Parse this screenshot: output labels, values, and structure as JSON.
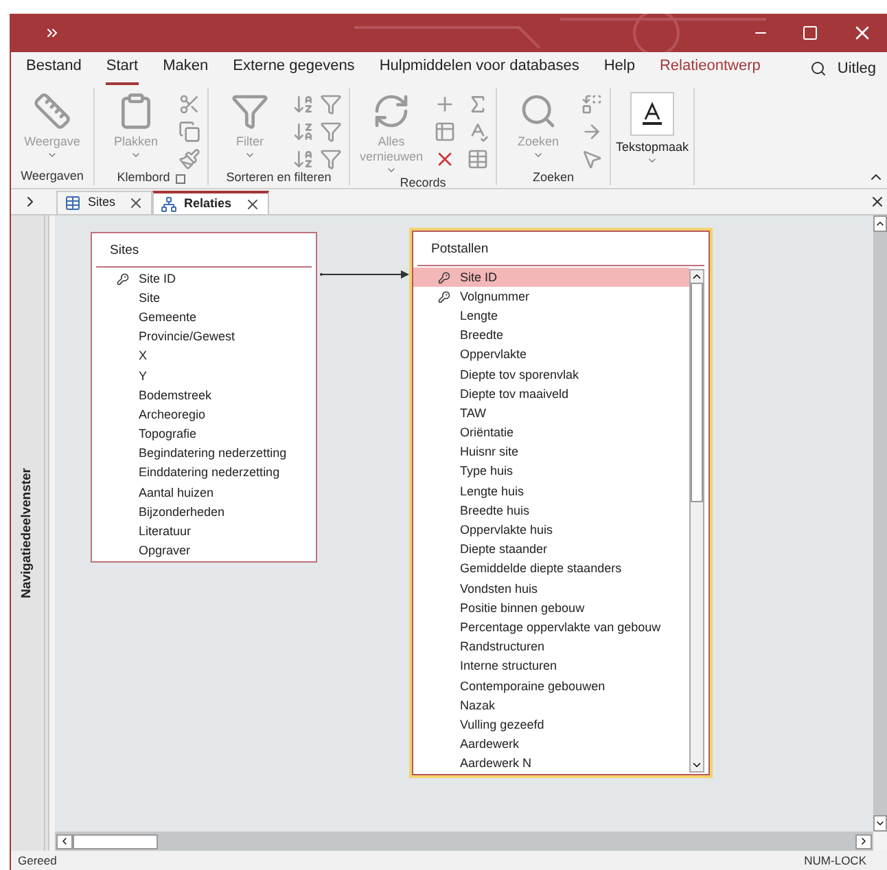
{
  "menu": [
    {
      "label": "Bestand",
      "selected": false,
      "contextual": false
    },
    {
      "label": "Start",
      "selected": true,
      "contextual": false
    },
    {
      "label": "Maken",
      "selected": false,
      "contextual": false
    },
    {
      "label": "Externe gegevens",
      "selected": false,
      "contextual": false
    },
    {
      "label": "Hulpmiddelen voor databases",
      "selected": false,
      "contextual": false
    },
    {
      "label": "Help",
      "selected": false,
      "contextual": false
    },
    {
      "label": "Relatieontwerp",
      "selected": false,
      "contextual": true
    }
  ],
  "tell_me": "Uitleg",
  "ribbon": {
    "groups": [
      {
        "kind": "views",
        "label": "Weergaven",
        "large": {
          "label": "Weergave",
          "disabled": true
        }
      },
      {
        "kind": "clipboard",
        "label": "Klembord",
        "launcher": true,
        "large": {
          "label": "Plakken",
          "disabled": true
        }
      },
      {
        "kind": "sort",
        "label": "Sorteren en filteren",
        "large": {
          "label": "Filter",
          "disabled": true
        }
      },
      {
        "kind": "records",
        "label": "Records",
        "large": {
          "label": "Alles vernieuwen",
          "disabled": true
        }
      },
      {
        "kind": "find",
        "label": "Zoeken",
        "large": {
          "label": "Zoeken",
          "disabled": true
        }
      },
      {
        "kind": "text",
        "large": {
          "label": "Tekstopmaak",
          "disabled": false
        }
      }
    ]
  },
  "doc_tabs": [
    {
      "label": "Sites",
      "kind": "table",
      "selected": false
    },
    {
      "label": "Relaties",
      "kind": "relations",
      "selected": true
    }
  ],
  "nav_pane": {
    "title": "Navigatiedeelvenster"
  },
  "tables": [
    {
      "title": "Sites",
      "active": false,
      "scrollbar": false,
      "fields": [
        {
          "name": "Site ID",
          "key": true,
          "selected": false
        },
        {
          "name": "Site",
          "key": false,
          "selected": false
        },
        {
          "name": "Gemeente",
          "key": false,
          "selected": false
        },
        {
          "name": "Provincie/Gewest",
          "key": false,
          "selected": false
        },
        {
          "name": "X",
          "key": false,
          "selected": false
        },
        {
          "name": "Y",
          "key": false,
          "selected": false
        },
        {
          "name": "Bodemstreek",
          "key": false,
          "selected": false
        },
        {
          "name": "Archeoregio",
          "key": false,
          "selected": false
        },
        {
          "name": "Topografie",
          "key": false,
          "selected": false
        },
        {
          "name": "Begindatering nederzetting",
          "key": false,
          "selected": false
        },
        {
          "name": "Einddatering nederzetting",
          "key": false,
          "selected": false
        },
        {
          "name": "Aantal huizen",
          "key": false,
          "selected": false
        },
        {
          "name": "Bijzonderheden",
          "key": false,
          "selected": false
        },
        {
          "name": "Literatuur",
          "key": false,
          "selected": false
        },
        {
          "name": "Opgraver",
          "key": false,
          "selected": false
        }
      ]
    },
    {
      "title": "Potstallen",
      "active": true,
      "scrollbar": true,
      "fields": [
        {
          "name": "Site ID",
          "key": true,
          "selected": true
        },
        {
          "name": "Volgnummer",
          "key": true,
          "selected": false
        },
        {
          "name": "Lengte",
          "key": false,
          "selected": false
        },
        {
          "name": "Breedte",
          "key": false,
          "selected": false
        },
        {
          "name": "Oppervlakte",
          "key": false,
          "selected": false
        },
        {
          "name": "Diepte tov sporenvlak",
          "key": false,
          "selected": false
        },
        {
          "name": "Diepte tov maaiveld",
          "key": false,
          "selected": false
        },
        {
          "name": "TAW",
          "key": false,
          "selected": false
        },
        {
          "name": "Oriëntatie",
          "key": false,
          "selected": false
        },
        {
          "name": "Huisnr site",
          "key": false,
          "selected": false
        },
        {
          "name": "Type huis",
          "key": false,
          "selected": false
        },
        {
          "name": "Lengte huis",
          "key": false,
          "selected": false
        },
        {
          "name": "Breedte huis",
          "key": false,
          "selected": false
        },
        {
          "name": "Oppervlakte huis",
          "key": false,
          "selected": false
        },
        {
          "name": "Diepte staander",
          "key": false,
          "selected": false
        },
        {
          "name": "Gemiddelde diepte staanders",
          "key": false,
          "selected": false
        },
        {
          "name": "Vondsten huis",
          "key": false,
          "selected": false
        },
        {
          "name": "Positie binnen gebouw",
          "key": false,
          "selected": false
        },
        {
          "name": "Percentage oppervlakte van gebouw",
          "key": false,
          "selected": false
        },
        {
          "name": "Randstructuren",
          "key": false,
          "selected": false
        },
        {
          "name": "Interne structuren",
          "key": false,
          "selected": false
        },
        {
          "name": "Contemporaine gebouwen",
          "key": false,
          "selected": false
        },
        {
          "name": "Nazak",
          "key": false,
          "selected": false
        },
        {
          "name": "Vulling gezeefd",
          "key": false,
          "selected": false
        },
        {
          "name": "Aardewerk",
          "key": false,
          "selected": false
        },
        {
          "name": "Aardewerk N",
          "key": false,
          "selected": false
        }
      ]
    }
  ],
  "status_bar": {
    "left": "Gereed",
    "right": "NUM-LOCK"
  }
}
